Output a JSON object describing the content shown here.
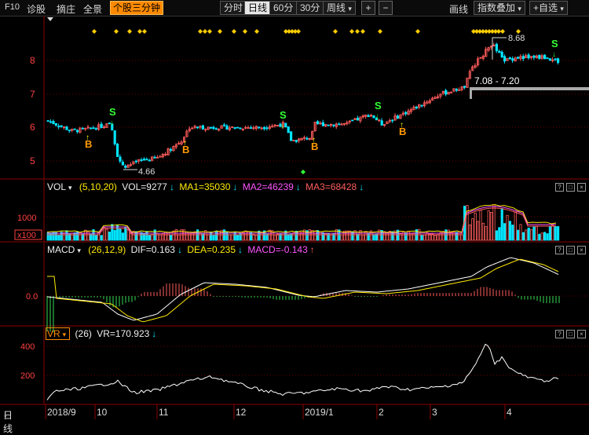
{
  "toolbar": {
    "f10": "F10",
    "diagnose": "诊股",
    "pick": "摘庄",
    "panorama": "全景",
    "three_min": "个股三分钟",
    "period_tabs": [
      "分时",
      "日线",
      "60分",
      "30分",
      "周线"
    ],
    "period_active": "日线",
    "plus": "+",
    "minus": "−",
    "draw": "画线",
    "overlay": "指数叠加",
    "self_select": "+自选"
  },
  "price_panel": {
    "y_labels": [
      "8",
      "7",
      "6",
      "5"
    ],
    "high_label": "8.68",
    "low_label": "4.66",
    "range_label": "7.08 - 7.20",
    "buy_label": "B",
    "sell_label": "S"
  },
  "vol_panel": {
    "name": "VOL",
    "params": "(5,10,20)",
    "vol": "VOL=9277",
    "ma1": "MA1=35030",
    "ma2": "MA2=46239",
    "ma3": "MA3=68428",
    "y_label": "1000",
    "unit": "x100"
  },
  "macd_panel": {
    "name": "MACD",
    "params": "(26,12,9)",
    "dif": "DIF=0.163",
    "dea": "DEA=0.235",
    "macd": "MACD=-0.143",
    "y_label": "0.0"
  },
  "vr_panel": {
    "name": "VR",
    "params": "(26)",
    "vr": "VR=170.923",
    "y_labels": [
      "400",
      "200"
    ]
  },
  "panel_buttons": [
    "?",
    "□",
    "×"
  ],
  "bottom": {
    "period": "日线",
    "dates": [
      "2018/9",
      "10",
      "11",
      "12",
      "2019/1",
      "2",
      "3",
      "4"
    ]
  },
  "colors": {
    "up": "#ff5c5c",
    "down": "#00e5ff",
    "accent": "#ff8a00",
    "grid": "#8b0000",
    "signal_buy": "#ff9900",
    "signal_sell": "#33ff33",
    "diamond": "#ffcc00"
  },
  "icons": [
    "arrow-down-icon",
    "dropdown-icon",
    "close-icon",
    "maximize-icon",
    "help-icon"
  ]
}
